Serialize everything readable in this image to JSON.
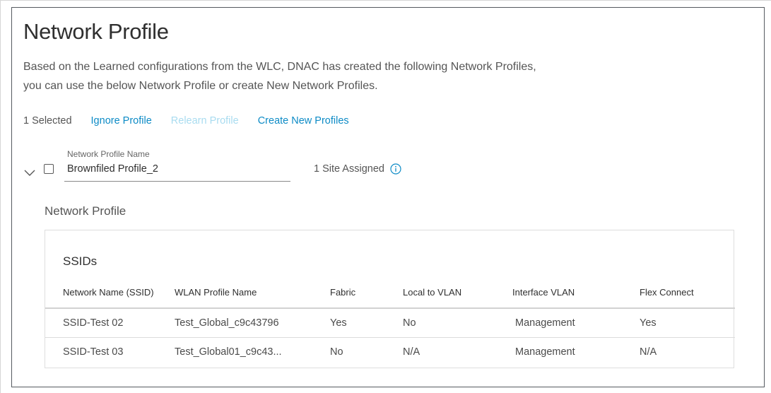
{
  "page": {
    "title": "Network Profile",
    "description_line1": "Based on the Learned configurations from the WLC, DNAC has created the following Network Profiles,",
    "description_line2": "you can use the below Network Profile or create New Network Profiles."
  },
  "actions": {
    "selected_count": "1 Selected",
    "ignore_profile": "Ignore Profile",
    "relearn_profile": "Relearn Profile",
    "create_new_profiles": "Create New Profiles"
  },
  "profile": {
    "field_label": "Network Profile Name",
    "name": "Brownfiled Profile_2",
    "site_assigned": "1 Site Assigned",
    "checked": false
  },
  "section": {
    "title": "Network Profile"
  },
  "ssids": {
    "title": "SSIDs",
    "columns": [
      "Network Name (SSID)",
      "WLAN Profile Name",
      "Fabric",
      "Local to VLAN",
      "Interface VLAN",
      "Flex Connect"
    ],
    "rows": [
      [
        "SSID-Test 02",
        "Test_Global_c9c43796",
        "Yes",
        "No",
        "Management",
        "Yes"
      ],
      [
        "SSID-Test 03",
        "Test_Global01_c9c43...",
        "No",
        "N/A",
        "Management",
        "N/A"
      ]
    ]
  },
  "colors": {
    "link": "#0d8bc6",
    "link_disabled": "#a9dcf0",
    "text": "#4a4a4a",
    "border": "#555a60"
  },
  "icons": {
    "expand": "chevron-down-icon",
    "info": "info-icon"
  }
}
